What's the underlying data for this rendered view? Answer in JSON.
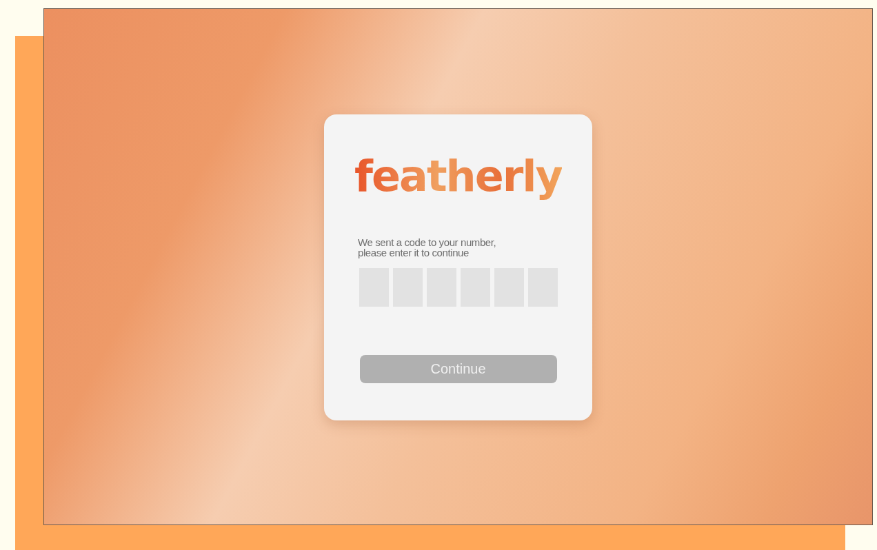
{
  "logo": {
    "text": "featherly"
  },
  "message": "We sent a code to your number,\nplease enter it to continue",
  "code_fields": [
    {
      "kind": "digit"
    },
    {
      "kind": "digit"
    },
    {
      "kind": "digit"
    },
    {
      "kind": "digit"
    },
    {
      "kind": "digit"
    },
    {
      "kind": "digit"
    }
  ],
  "continue_button": {
    "label": "Continue",
    "disabled": true
  }
}
